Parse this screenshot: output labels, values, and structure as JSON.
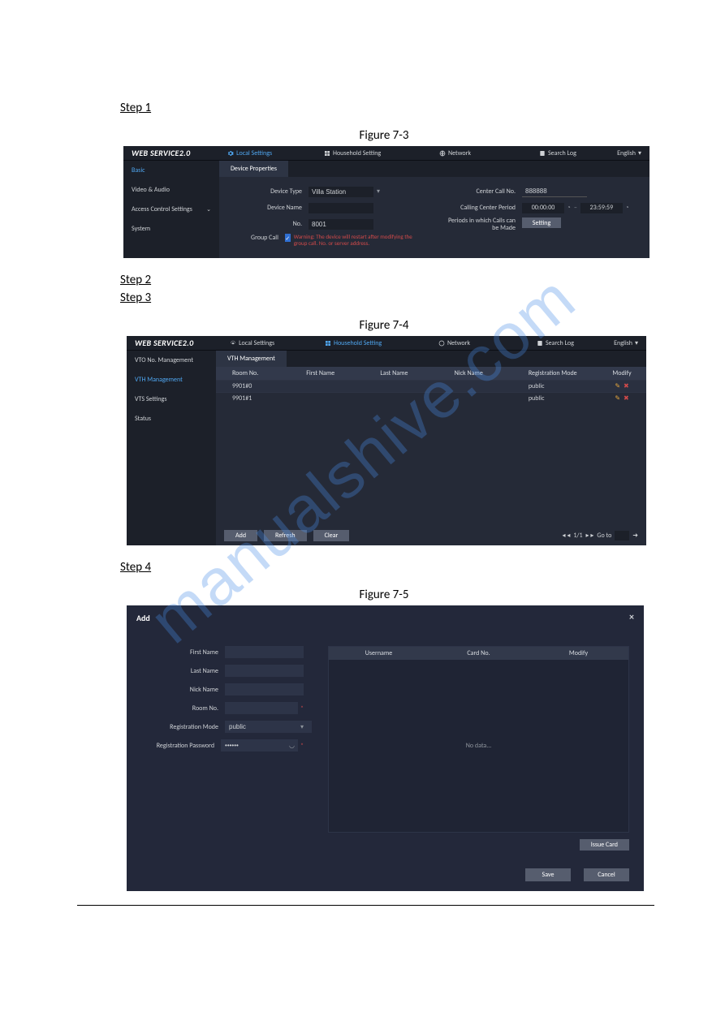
{
  "watermark": "manualshive.com",
  "steps": {
    "s1": "Step 1",
    "s2": "Step 2",
    "s3": "Step 3",
    "s4": "Step 4"
  },
  "fig": {
    "f73": "Figure 7-3",
    "f74": "Figure 7-4",
    "f75": "Figure 7-5"
  },
  "brand": "WEB SERVICE2.0",
  "nav": {
    "local": "Local Settings",
    "household": "Household Setting",
    "network": "Network",
    "search": "Search Log",
    "lang": "English"
  },
  "shot1": {
    "side": {
      "basic": "Basic",
      "va": "Video & Audio",
      "acs": "Access Control Settings",
      "system": "System"
    },
    "tab": "Device Properties",
    "left": {
      "devtype_l": "Device Type",
      "devtype_v": "Villa Station",
      "devname_l": "Device Name",
      "no_l": "No.",
      "no_v": "8001",
      "group_l": "Group Call",
      "warn": "Warning: The device will restart after modifying the group call. No. or server address."
    },
    "right": {
      "center_l": "Center Call No.",
      "center_v": "888888",
      "period_l": "Calling Center Period",
      "from": "00:00:00",
      "to": "23:59:59",
      "sep": "–",
      "pcalls_l": "Periods in which Calls can be Made",
      "setting": "Setting"
    }
  },
  "shot2": {
    "side": {
      "vto": "VTO No. Management",
      "vth": "VTH Management",
      "vts": "VTS Settings",
      "status": "Status"
    },
    "tab": "VTH Management",
    "cols": {
      "room": "Room No.",
      "first": "First Name",
      "last": "Last Name",
      "nick": "Nick Name",
      "reg": "Registration Mode",
      "mod": "Modify"
    },
    "rows": [
      {
        "room": "9901#0",
        "first": "",
        "last": "",
        "nick": "",
        "reg": "public"
      },
      {
        "room": "9901#1",
        "first": "",
        "last": "",
        "nick": "",
        "reg": "public"
      }
    ],
    "btns": {
      "add": "Add",
      "refresh": "Refresh",
      "clear": "Clear"
    },
    "pager": {
      "left": "◂ ◂",
      "count": "1/1",
      "right": "▸ ▸",
      "go": "Go to",
      "jump": "➜"
    }
  },
  "shot3": {
    "title": "Add",
    "labels": {
      "first": "First Name",
      "last": "Last Name",
      "nick": "Nick Name",
      "room": "Room No.",
      "regmode": "Registration Mode",
      "regpwd": "Registration Password"
    },
    "vals": {
      "regmode": "public",
      "regpwd": "••••••"
    },
    "card": {
      "cols": {
        "user": "Username",
        "cardno": "Card No.",
        "mod": "Modify"
      },
      "nodata": "No data...",
      "issue": "Issue Card"
    },
    "btns": {
      "save": "Save",
      "cancel": "Cancel"
    }
  }
}
